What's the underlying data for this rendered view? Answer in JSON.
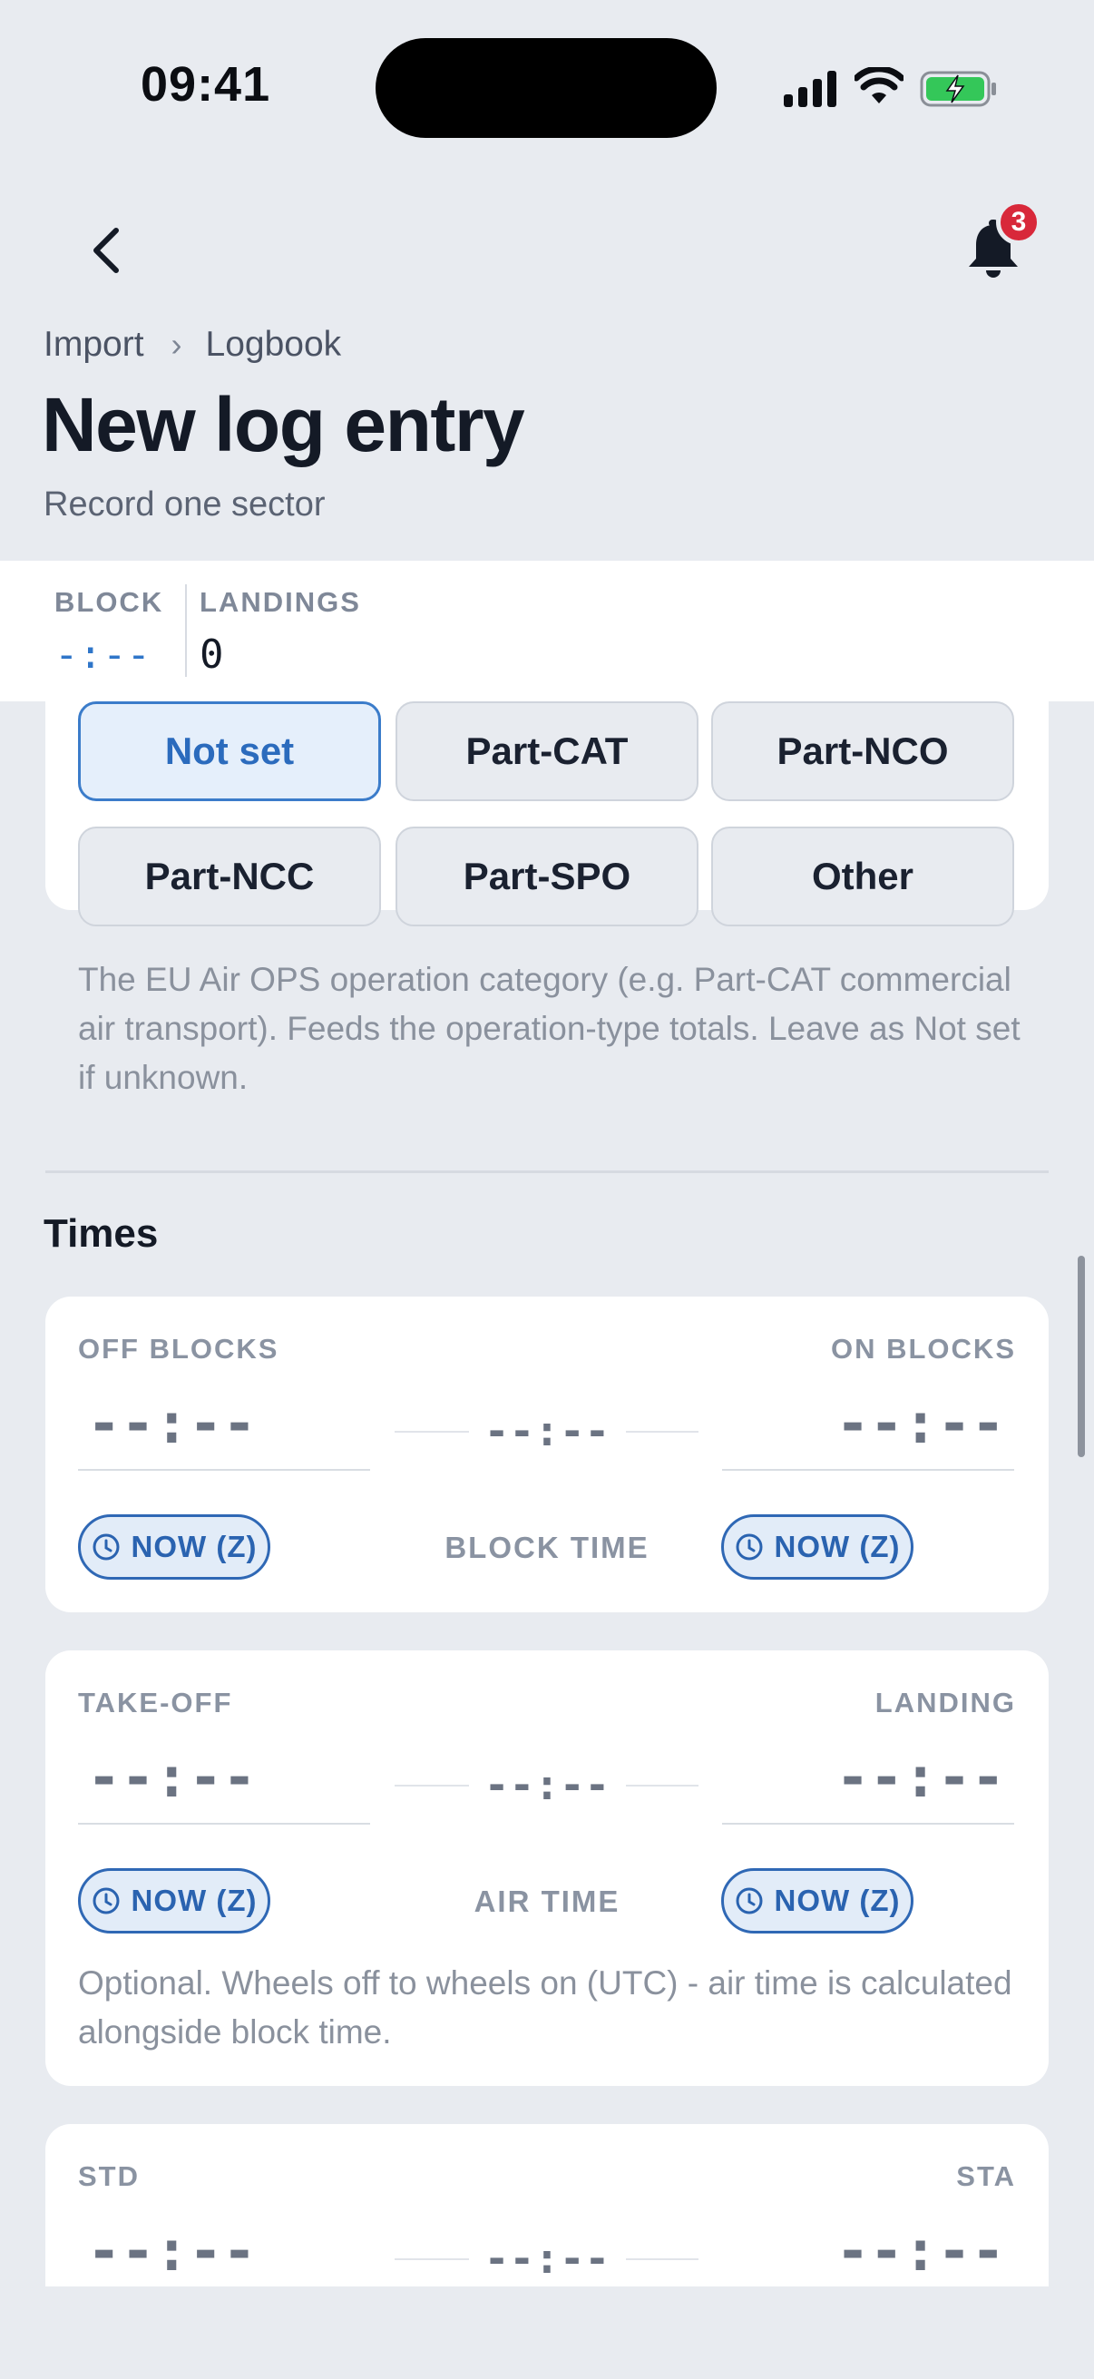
{
  "status_bar": {
    "time": "09:41"
  },
  "header": {
    "notification_count": "3",
    "breadcrumb": {
      "parent": "Import",
      "current": "Logbook"
    },
    "title": "New log entry",
    "subtitle": "Record one sector"
  },
  "summary": {
    "block_label": "BLOCK",
    "block_value": "-:--",
    "landings_label": "LANDINGS",
    "landings_value": "0"
  },
  "operation": {
    "options": [
      "Not set",
      "Part-CAT",
      "Part-NCO",
      "Part-NCC",
      "Part-SPO",
      "Other"
    ],
    "selected": "Not set",
    "help": "The EU Air OPS operation category (e.g. Part-CAT commercial air transport). Feeds the operation-type totals. Leave as Not set if unknown."
  },
  "times": {
    "section_title": "Times",
    "block_card": {
      "left_label": "OFF BLOCKS",
      "right_label": "ON BLOCKS",
      "left_value": "--:--",
      "right_value": "--:--",
      "middle_value": "--:--",
      "middle_caption": "BLOCK TIME",
      "now_label": "NOW (Z)"
    },
    "air_card": {
      "left_label": "TAKE-OFF",
      "right_label": "LANDING",
      "left_value": "--:--",
      "right_value": "--:--",
      "middle_value": "--:--",
      "middle_caption": "AIR TIME",
      "now_label": "NOW (Z)",
      "help": "Optional. Wheels off to wheels on (UTC) - air time is calculated alongside block time."
    },
    "schedule_card": {
      "left_label": "STD",
      "right_label": "STA",
      "left_value": "--:--",
      "right_value": "--:--",
      "middle_value": "--:--"
    }
  },
  "colors": {
    "accent": "#2f68b5",
    "badge": "#d8283a",
    "background": "#e8ebf0"
  }
}
